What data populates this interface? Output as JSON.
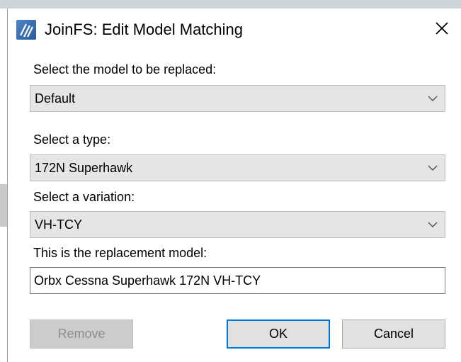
{
  "window": {
    "title": "JoinFS: Edit Model Matching",
    "icon": "joinfs-app-icon",
    "close_icon": "close-icon"
  },
  "model_to_replace": {
    "label": "Select the model to be replaced:",
    "value": "Default"
  },
  "type": {
    "label": "Select a type:",
    "value": "172N Superhawk"
  },
  "variation": {
    "label": "Select a variation:",
    "value": "VH-TCY"
  },
  "replacement": {
    "label": "This is the replacement model:",
    "value": "Orbx Cessna Superhawk 172N VH-TCY"
  },
  "buttons": {
    "remove": "Remove",
    "ok": "OK",
    "cancel": "Cancel"
  },
  "colors": {
    "default_button_border": "#0078d7",
    "combo_background": "#e5e5e5",
    "disabled_text": "#8d8d8d"
  }
}
